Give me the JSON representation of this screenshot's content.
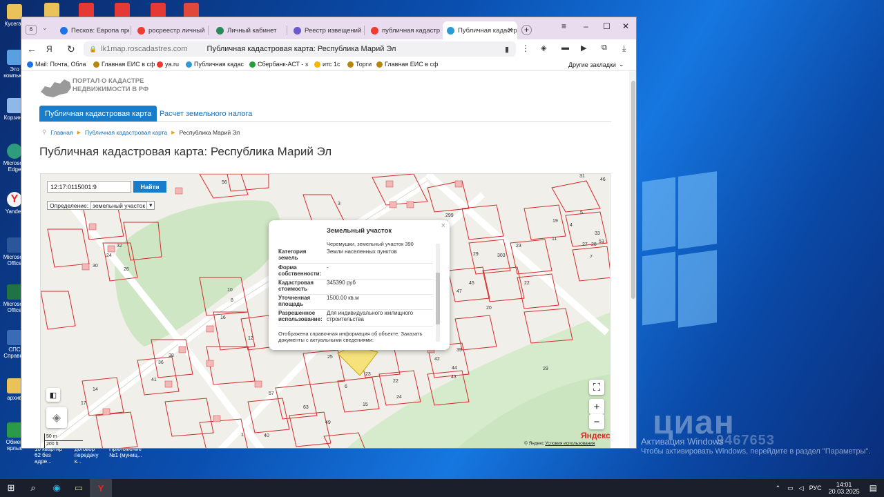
{
  "desktop": {
    "icons": [
      {
        "label": "Кусеган",
        "color": "#e9c35a"
      },
      {
        "label": "Это компьют",
        "color": "#5aa0e0"
      },
      {
        "label": "Корзина",
        "color": "#8fb8e8"
      },
      {
        "label": "Microsoft Edge",
        "color": "#2d9b7c"
      },
      {
        "label": "Yandex",
        "color": "#f4f4f4"
      },
      {
        "label": "Microsoft Office",
        "color": "#2b579a"
      },
      {
        "label": "Microsoft Office",
        "color": "#217346"
      },
      {
        "label": "СПС Справка",
        "color": "#3a6bb5"
      },
      {
        "label": "архив",
        "color": "#e9c35a"
      },
      {
        "label": "Обмен ярлык",
        "color": "#2a9a4a"
      }
    ],
    "bottom_files": [
      "10 квартир 62 без адре...",
      "договор передачу к...",
      "Приложение №1 (муниц..."
    ],
    "activation_title": "Активация Windows",
    "activation_sub": "Чтобы активировать Windows, перейдите в раздел \"Параметры\".",
    "watermark": "циан",
    "watermark_number": "9467653"
  },
  "taskbar": {
    "lang": "РУС",
    "time": "14:01",
    "date": "20.03.2025"
  },
  "browser": {
    "tab_count": "6",
    "tabs": [
      {
        "title": "Песков: Европа пре",
        "color": "#1a73e8"
      },
      {
        "title": "росреестр личный к",
        "color": "#f03a2e"
      },
      {
        "title": "Личный кабинет",
        "color": "#2a8a5a"
      },
      {
        "title": "Реестр извещений",
        "color": "#6a5acd"
      },
      {
        "title": "публичная кадастра",
        "color": "#f03a2e"
      },
      {
        "title": "Публичная кадастр",
        "color": "#2a9ad8"
      }
    ],
    "url": "lk1map.roscadastres.com",
    "page_title": "Публичная кадастровая карта: Республика Марий Эл",
    "bookmarks": [
      {
        "label": "Mail: Почта, Обла",
        "color": "#1a73e8"
      },
      {
        "label": "Главная ЕИС в сф",
        "color": "#b8860b"
      },
      {
        "label": "ya.ru",
        "color": "#f03a2e"
      },
      {
        "label": "Публичная кадас",
        "color": "#2a9ad8"
      },
      {
        "label": "Сбербанк-АСТ - з",
        "color": "#21a038"
      },
      {
        "label": "итс 1с",
        "color": "#f7b500"
      },
      {
        "label": "Торги",
        "color": "#b8860b"
      },
      {
        "label": "Главная ЕИС в сф",
        "color": "#b8860b"
      }
    ],
    "other_bookmarks": "Другие закладки"
  },
  "site": {
    "logo_line1": "ПОРТАЛ О КАДАСТРЕ",
    "logo_line2": "НЕДВИЖИМОСТИ В РФ",
    "nav_active": "Публичная кадастровая карта",
    "nav_other": "Расчет земельного налога",
    "breadcrumbs": [
      "Главная",
      "Публичная кадастровая карта",
      "Республика Марий Эл"
    ],
    "heading": "Публичная кадастровая карта: Республика Марий Эл"
  },
  "map": {
    "search_value": "12:17:0115001:9",
    "find_label": "Найти",
    "definition_label": "Определение:",
    "definition_value": "земельный участок",
    "scale_1": "50 m",
    "scale_2": "200 ft",
    "brand": "Яндекс",
    "brand_note": "© Яндекс",
    "terms": "Условия использования",
    "parcel_numbers": [
      "56",
      "3",
      "299",
      "29",
      "303",
      "45",
      "47",
      "20",
      "22",
      "23",
      "19",
      "5",
      "4",
      "27",
      "11",
      "28",
      "7",
      "10",
      "8",
      "16",
      "12",
      "26",
      "25",
      "23",
      "6",
      "15",
      "24",
      "22",
      "57",
      "63",
      "49",
      "40",
      "1",
      "17",
      "14",
      "32",
      "24",
      "26",
      "30",
      "36",
      "38",
      "41",
      "42",
      "43",
      "44",
      "39",
      "29",
      "31",
      "46",
      "33",
      "53",
      "18"
    ]
  },
  "popup": {
    "title": "Земельный участок",
    "top_line": "Черемушки, земельный участок 390",
    "rows": [
      {
        "key": "Категория земель",
        "value": "Земли населенных пунктов"
      },
      {
        "key": "Форма собственности:",
        "value": "-"
      },
      {
        "key": "Кадастровая стоимость",
        "value": "345390 руб"
      },
      {
        "key": "Уточненная площадь",
        "value": "1500.00 кв.м"
      },
      {
        "key": "Разрешенное использование:",
        "value": "Для индивидуального жилищного строительства"
      }
    ],
    "footer": "Отображена справочная информация об объекте. Заказать документы с актуальными сведениями:"
  }
}
